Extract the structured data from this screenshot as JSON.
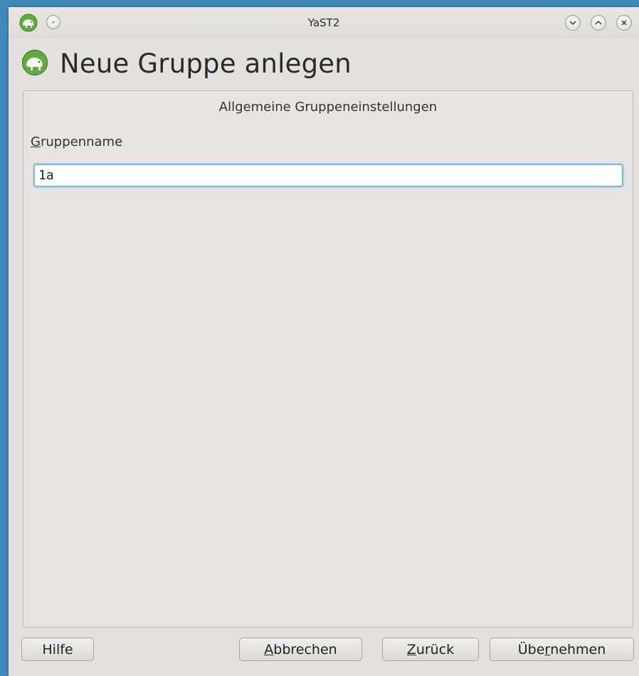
{
  "window": {
    "title": "YaST2"
  },
  "heading": {
    "title": "Neue Gruppe anlegen"
  },
  "frame": {
    "title": "Allgemeine Gruppeneinstellungen"
  },
  "group_name": {
    "label_accel": "G",
    "label_rest": "ruppenname",
    "value": "1a"
  },
  "buttons": {
    "help": {
      "label": "Hilfe"
    },
    "cancel": {
      "accel": "A",
      "rest": "bbrechen"
    },
    "back": {
      "accel": "Z",
      "rest": "urück"
    },
    "apply": {
      "pre": "Übe",
      "accel": "r",
      "post": "nehmen"
    }
  },
  "icons": {
    "app": "yast-chameleon-icon",
    "menu": "window-menu-icon",
    "minimize": "minimize-icon",
    "maximize": "maximize-icon",
    "close": "close-icon"
  },
  "colors": {
    "desktop": "#3f8ab8",
    "window_bg": "#e3e0dd",
    "focus_border": "#77b6e3",
    "icon_green": "#5fae3a"
  }
}
